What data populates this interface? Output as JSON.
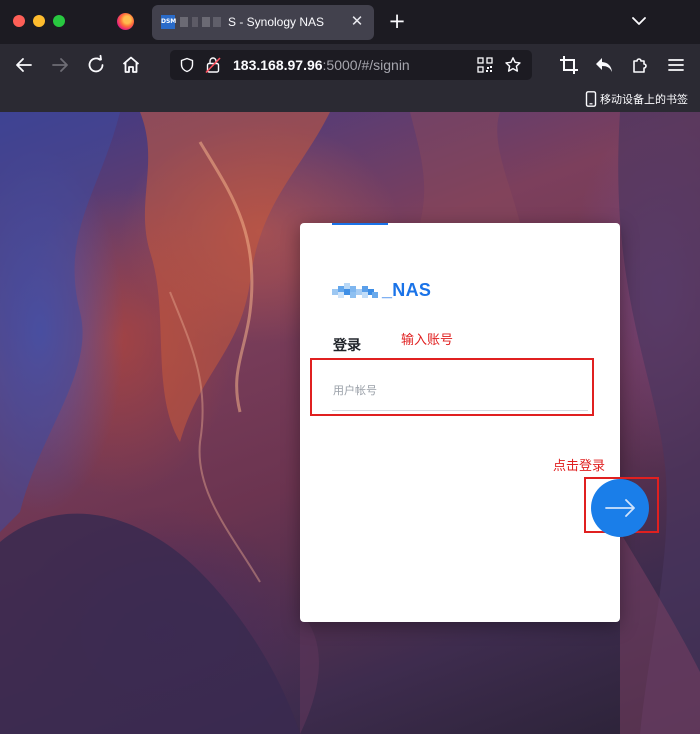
{
  "browser": {
    "tab": {
      "favicon": "DSM",
      "title": "S - Synology NAS"
    },
    "url": {
      "host": "183.168.97.96",
      "rest": ":5000/#/signin"
    },
    "bookmarks": {
      "mobile_label": "移动设备上的书签"
    }
  },
  "page": {
    "logo_text": "_NAS",
    "login_heading": "登录",
    "username_placeholder": "用户帐号"
  },
  "annotations": {
    "input_hint": "输入账号",
    "click_hint": "点击登录"
  },
  "colors": {
    "accent": "#1a7ee9",
    "annotation": "#e02020"
  },
  "icons": [
    "firefox-logo-icon",
    "close-icon",
    "plus-icon",
    "chevron-down-icon",
    "back-arrow-icon",
    "forward-arrow-icon",
    "reload-icon",
    "home-icon",
    "shield-icon",
    "lock-icon",
    "qr-code-icon",
    "star-icon",
    "crop-icon",
    "reply-icon",
    "extensions-icon",
    "menu-icon",
    "mobile-device-icon",
    "arrow-right-icon"
  ]
}
